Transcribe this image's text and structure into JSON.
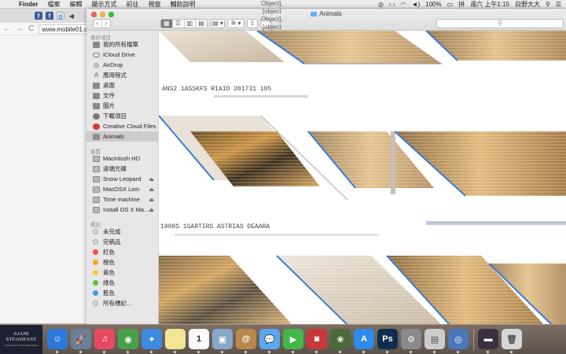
{
  "menubar": {
    "apple": "",
    "items": [
      "Finder",
      "檔案",
      "編輯",
      "顯示方式",
      "前往",
      "視窗",
      "輔助說明"
    ],
    "battery": "100%",
    "input_method": "拼",
    "clock": "週六 上午1:15",
    "user": "白野大大"
  },
  "browser": {
    "url": "www.mobile01.c",
    "tab_icons": [
      "f",
      "f",
      "g",
      "◀"
    ]
  },
  "finder": {
    "title": "Animals",
    "back": "‹",
    "forward": "›",
    "view_buttons": [
      "▦",
      "☰",
      "▥",
      "▤"
    ],
    "arrange": "▤ ▾",
    "action": "✲ ▾",
    "share": "⇧",
    "tags": [
      {
        "label": "未完成",
        "color": "#d8d8d8"
      },
      {
        "label": "完稿品",
        "color": "#d8d8d8"
      },
      {
        "label": "紅色",
        "color": "#f0524f"
      },
      {
        "label": "橙色",
        "color": "#f5a623"
      },
      {
        "label": "黃色",
        "color": "#f3d33a"
      },
      {
        "label": "綠色",
        "color": "#5cc244"
      },
      {
        "label": "藍色",
        "color": "#3a9be0"
      },
      {
        "label": "所有標記…",
        "color": "#d8d8d8"
      }
    ],
    "search_placeholder": "",
    "sections": {
      "favorites": "喜好項目",
      "devices": "裝置",
      "tags": "標記"
    },
    "favorites": [
      {
        "label": "我的所有檔案",
        "icon": "files-icon"
      },
      {
        "label": "iCloud Drive",
        "icon": "cloud-icon"
      },
      {
        "label": "AirDrop",
        "icon": "airdrop-icon"
      },
      {
        "label": "應用程式",
        "icon": "applications-icon"
      },
      {
        "label": "桌面",
        "icon": "desktop-icon"
      },
      {
        "label": "文件",
        "icon": "documents-icon"
      },
      {
        "label": "圖片",
        "icon": "pictures-icon"
      },
      {
        "label": "下載項目",
        "icon": "downloads-icon"
      },
      {
        "label": "Creative Cloud Files",
        "icon": "creative-cloud-icon"
      },
      {
        "label": "Animals",
        "icon": "folder-icon",
        "selected": true
      }
    ],
    "devices": [
      {
        "label": "Macintosh HD",
        "icon": "disk-icon",
        "eject": false
      },
      {
        "label": "遠端光碟",
        "icon": "remote-disc-icon",
        "eject": false
      },
      {
        "label": "Snow Leopard",
        "icon": "disk-icon",
        "eject": true
      },
      {
        "label": "MacOSX Lion",
        "icon": "disk-icon",
        "eject": true
      },
      {
        "label": "Time machine",
        "icon": "disk-icon",
        "eject": true
      },
      {
        "label": "Install OS X Ma…",
        "icon": "disk-icon",
        "eject": true
      }
    ],
    "content": {
      "garbled_rows": [
        "ANS2  1ASSKFS RIAID  201731  105",
        "1988S  1SARTIRS ASTRIAS  DEAARA"
      ]
    }
  },
  "dock": {
    "brand_title": "AJANI STEADFAST",
    "brand_sub": "LEGENDS OF DOMINARIA",
    "calendar_day": "1",
    "apps": [
      {
        "icon": "finder-icon",
        "label": "☺",
        "color": "#2a78d8"
      },
      {
        "icon": "launchpad-icon",
        "label": "🚀",
        "color": "#6b7f99"
      },
      {
        "icon": "itunes-icon",
        "label": "♫",
        "color": "#e84860"
      },
      {
        "icon": "chrome-icon",
        "label": "◉",
        "color": "#4aa04a"
      },
      {
        "icon": "safari-icon",
        "label": "✦",
        "color": "#3d8be0"
      },
      {
        "icon": "notes-icon",
        "label": "",
        "color": "#f2e596"
      },
      {
        "icon": "calendar-icon",
        "label": "1",
        "color": "#fafafa"
      },
      {
        "icon": "preview-icon",
        "label": "▣",
        "color": "#86a8c8"
      },
      {
        "icon": "contacts-icon",
        "label": "@",
        "color": "#b8884c"
      },
      {
        "icon": "messages-icon",
        "label": "💬",
        "color": "#5aa8f0"
      },
      {
        "icon": "facetime-icon",
        "label": "▶",
        "color": "#42b84a"
      },
      {
        "icon": "photo-booth-icon",
        "label": "◙",
        "color": "#c83838"
      },
      {
        "icon": "iphoto-icon",
        "label": "❀",
        "color": "#4a6a3a"
      },
      {
        "icon": "app-store-icon",
        "label": "A",
        "color": "#2e8ae8"
      },
      {
        "icon": "photoshop-icon",
        "label": "Ps",
        "color": "#0f2d4d"
      },
      {
        "icon": "system-preferences-icon",
        "label": "⚙",
        "color": "#8a8a8a"
      },
      {
        "icon": "preview-app-icon",
        "label": "▤",
        "color": "#cccccc"
      },
      {
        "icon": "network-utility-icon",
        "label": "◎",
        "color": "#4a78b8"
      },
      {
        "icon": "folder-stack-icon",
        "label": "▬",
        "color": "#3a3040"
      },
      {
        "icon": "trash-icon",
        "label": "🗑",
        "color": "#d6d6d6"
      }
    ]
  }
}
